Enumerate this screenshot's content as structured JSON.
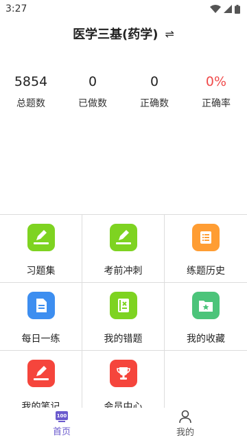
{
  "status_bar": {
    "time": "3:27"
  },
  "header": {
    "title": "医学三基(药学)",
    "switch_icon": "⇌"
  },
  "stats": [
    {
      "value": "5854",
      "label": "总题数"
    },
    {
      "value": "0",
      "label": "已做数"
    },
    {
      "value": "0",
      "label": "正确数"
    },
    {
      "value": "0%",
      "label": "正确率"
    }
  ],
  "menu": [
    {
      "label": "习题集",
      "icon": "pencil-icon",
      "color": "#7ed321"
    },
    {
      "label": "考前冲刺",
      "icon": "pencil-icon",
      "color": "#7ed321"
    },
    {
      "label": "练题历史",
      "icon": "scroll-icon",
      "color": "#ff9d33"
    },
    {
      "label": "每日一练",
      "icon": "document-icon",
      "color": "#3d8ef0"
    },
    {
      "label": "我的错题",
      "icon": "error-book-icon",
      "color": "#7ed321"
    },
    {
      "label": "我的收藏",
      "icon": "star-folder-icon",
      "color": "#4cc47a"
    },
    {
      "label": "我的笔记",
      "icon": "pencil-icon",
      "color": "#f5453c"
    },
    {
      "label": "会员中心",
      "icon": "trophy-icon",
      "color": "#f5453c"
    }
  ],
  "bottom_nav": [
    {
      "label": "首页",
      "icon": "home-100-icon",
      "active": true
    },
    {
      "label": "我的",
      "icon": "person-icon",
      "active": false
    }
  ],
  "colors": {
    "accent": "#6a5acd",
    "percent_red": "#f04a4a",
    "divider": "#dcdcdc"
  }
}
